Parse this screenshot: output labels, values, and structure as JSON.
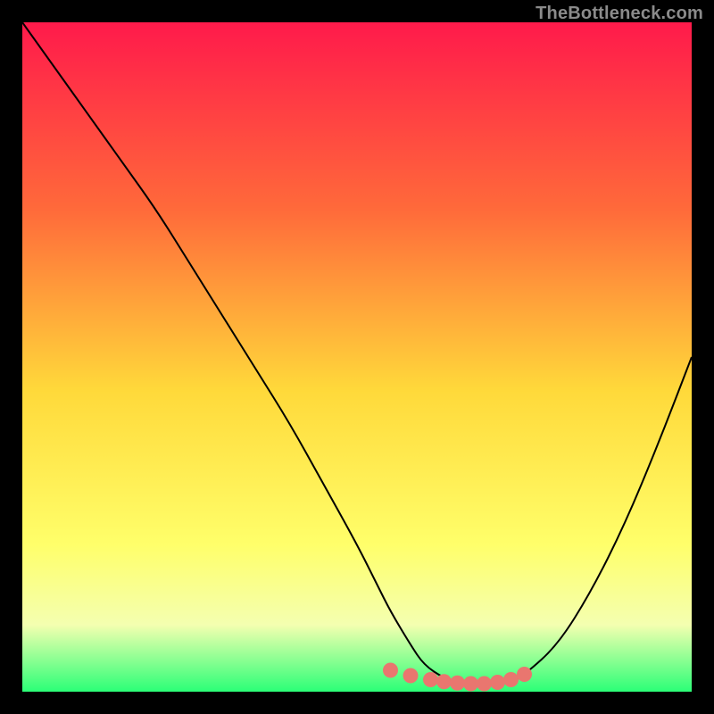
{
  "watermark": "TheBottleneck.com",
  "colors": {
    "gradient_top": "#ff1a4b",
    "gradient_mid_upper": "#ff6a3a",
    "gradient_mid": "#ffd93a",
    "gradient_lower": "#ffff6a",
    "gradient_bottom_pale": "#f4ffb0",
    "gradient_bottom": "#2bff77",
    "curve": "#000000",
    "marker": "#e9766f",
    "background": "#000000"
  },
  "chart_data": {
    "type": "line",
    "title": "",
    "xlabel": "",
    "ylabel": "",
    "xlim": [
      0,
      100
    ],
    "ylim": [
      0,
      100
    ],
    "series": [
      {
        "name": "bottleneck-curve",
        "x": [
          0,
          5,
          10,
          15,
          20,
          25,
          30,
          35,
          40,
          45,
          50,
          53,
          55,
          58,
          60,
          63,
          65,
          68,
          70,
          73,
          75,
          80,
          85,
          90,
          95,
          100
        ],
        "y": [
          100,
          93,
          86,
          79,
          72,
          64,
          56,
          48,
          40,
          31,
          22,
          16,
          12,
          7,
          4,
          2,
          1.5,
          1.2,
          1.2,
          1.5,
          2.5,
          7,
          15,
          25,
          37,
          50
        ]
      }
    ],
    "markers": {
      "name": "highlight-band",
      "x": [
        55,
        58,
        61,
        63,
        65,
        67,
        69,
        71,
        73,
        75
      ],
      "y": [
        3.2,
        2.4,
        1.8,
        1.5,
        1.3,
        1.2,
        1.2,
        1.4,
        1.8,
        2.6
      ]
    },
    "gradient_stops": [
      {
        "offset": 0.0,
        "key": "gradient_top"
      },
      {
        "offset": 0.28,
        "key": "gradient_mid_upper"
      },
      {
        "offset": 0.55,
        "key": "gradient_mid"
      },
      {
        "offset": 0.78,
        "key": "gradient_lower"
      },
      {
        "offset": 0.9,
        "key": "gradient_bottom_pale"
      },
      {
        "offset": 1.0,
        "key": "gradient_bottom"
      }
    ]
  }
}
